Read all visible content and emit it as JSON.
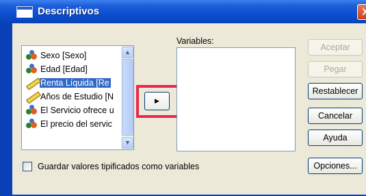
{
  "window": {
    "title": "Descriptivos",
    "close_glyph": "X"
  },
  "source_list": {
    "items": [
      {
        "label": "Sexo [Sexo]",
        "icon": "nominal-variable-icon",
        "selected": false
      },
      {
        "label": "Edad [Edad]",
        "icon": "nominal-variable-icon",
        "selected": false
      },
      {
        "label": "Renta Líquida [Re",
        "icon": "scale-variable-icon",
        "selected": true
      },
      {
        "label": "Años de Estudio [N",
        "icon": "scale-variable-icon",
        "selected": false
      },
      {
        "label": "El Servicio ofrece u",
        "icon": "nominal-variable-icon",
        "selected": false
      },
      {
        "label": "El precio del servic",
        "icon": "nominal-variable-icon",
        "selected": false
      }
    ],
    "scroll_up_glyph": "▲",
    "scroll_down_glyph": "▼"
  },
  "move_button": {
    "glyph": "▶"
  },
  "variables": {
    "label": "Variables:"
  },
  "buttons": {
    "accept": "Aceptar",
    "paste": "Pegar",
    "reset": "Restablecer",
    "cancel": "Cancelar",
    "help": "Ayuda",
    "options": "Opciones..."
  },
  "save_standardized": {
    "label": "Guardar valores tipificados como variables",
    "checked": false
  },
  "colors": {
    "highlight": "#e8264e",
    "selection": "#316ac5",
    "titlebar": "#0b4fd0"
  }
}
